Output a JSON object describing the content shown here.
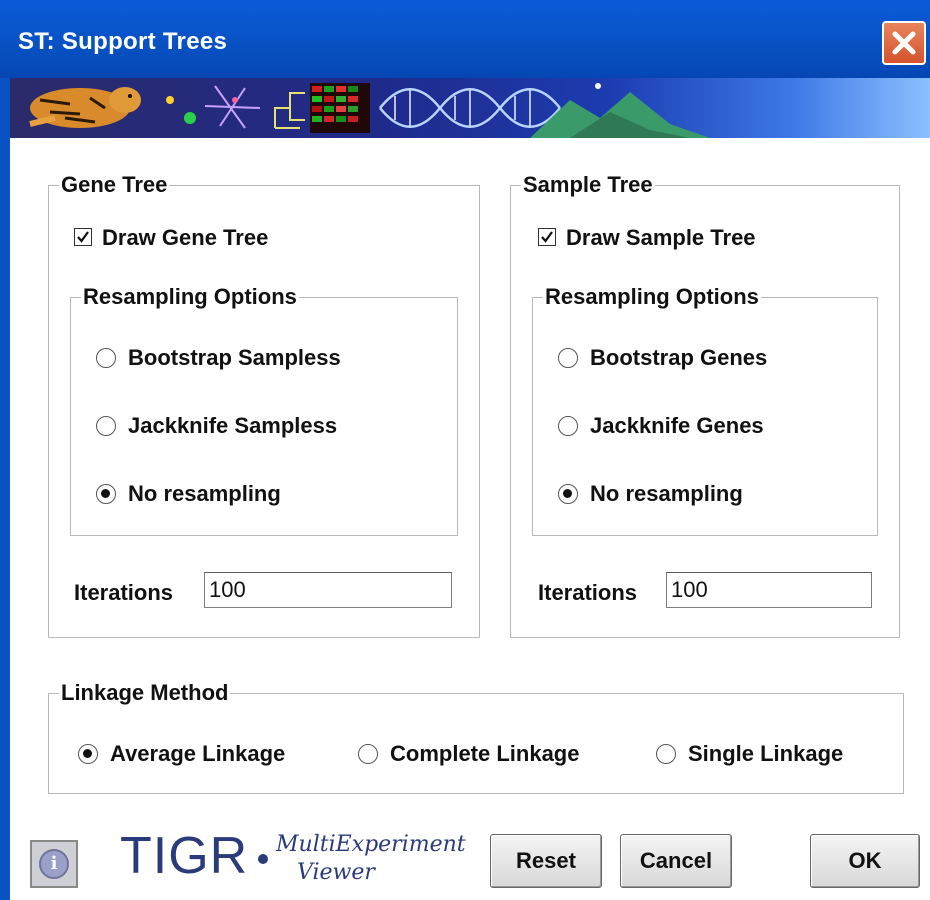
{
  "window": {
    "title": "ST: Support Trees"
  },
  "gene_tree": {
    "legend": "Gene Tree",
    "draw_label": "Draw Gene Tree",
    "draw_checked": true,
    "resampling_legend": "Resampling Options",
    "options": [
      {
        "label": "Bootstrap Sampless",
        "selected": false
      },
      {
        "label": "Jackknife Sampless",
        "selected": false
      },
      {
        "label": "No resampling",
        "selected": true
      }
    ],
    "iterations_label": "Iterations",
    "iterations_value": "100"
  },
  "sample_tree": {
    "legend": "Sample Tree",
    "draw_label": "Draw Sample Tree",
    "draw_checked": true,
    "resampling_legend": "Resampling Options",
    "options": [
      {
        "label": "Bootstrap Genes",
        "selected": false
      },
      {
        "label": "Jackknife Genes",
        "selected": false
      },
      {
        "label": "No resampling",
        "selected": true
      }
    ],
    "iterations_label": "Iterations",
    "iterations_value": "100"
  },
  "linkage": {
    "legend": "Linkage Method",
    "options": [
      {
        "label": "Average Linkage",
        "selected": true
      },
      {
        "label": "Complete Linkage",
        "selected": false
      },
      {
        "label": "Single Linkage",
        "selected": false
      }
    ]
  },
  "footer": {
    "logo_text": "TIGR",
    "logo_sub_line1": "MultiExperiment",
    "logo_sub_line2": "Viewer",
    "reset_label": "Reset",
    "cancel_label": "Cancel",
    "ok_label": "OK"
  },
  "colors": {
    "titlebar": "#0852c4",
    "close": "#d4532c"
  },
  "icons": {
    "close": "close-icon",
    "info": "info-icon",
    "check": "checkmark-icon"
  }
}
